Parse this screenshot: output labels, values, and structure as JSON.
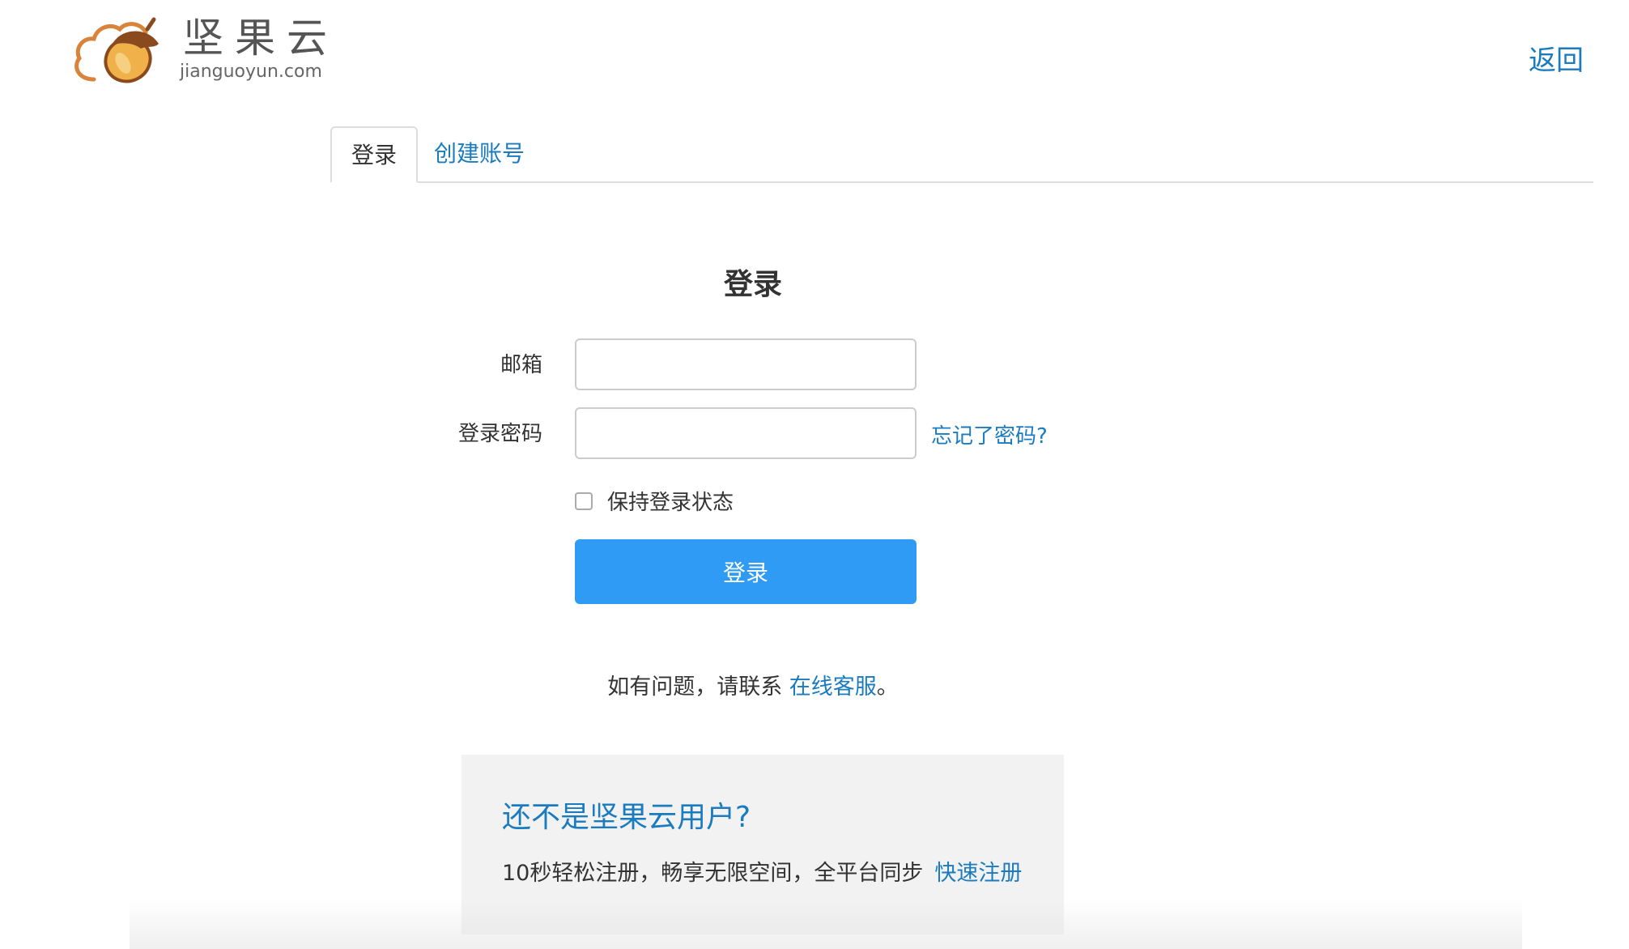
{
  "header": {
    "logo_cn": "坚果云",
    "logo_en": "jianguoyun.com",
    "back_label": "返回"
  },
  "tabs": [
    {
      "label": "登录",
      "active": true
    },
    {
      "label": "创建账号",
      "active": false
    }
  ],
  "form": {
    "title": "登录",
    "email_label": "邮箱",
    "email_value": "",
    "password_label": "登录密码",
    "password_value": "",
    "forgot_label": "忘记了密码?",
    "remember_label": "保持登录状态",
    "remember_checked": false,
    "submit_label": "登录"
  },
  "help": {
    "prefix": "如有问题，请联系 ",
    "link": "在线客服",
    "suffix": "。"
  },
  "promo": {
    "title": "还不是坚果云用户?",
    "text": "10秒轻松注册，畅享无限空间，全平台同步",
    "link": "快速注册"
  },
  "colors": {
    "accent": "#2f9bf4",
    "link": "#1b7bbf",
    "panel_bg": "#f2f2f2"
  },
  "icons": {
    "logo": "acorn-cloud-icon"
  }
}
